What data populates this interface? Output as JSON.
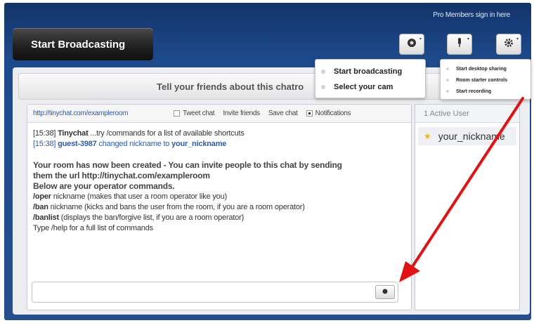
{
  "header": {
    "pro_link": "Pro Members sign in here",
    "start_button": "Start Broadcasting",
    "tools": [
      {
        "name": "camera-icon"
      },
      {
        "name": "microphone-icon"
      },
      {
        "name": "gear-icon"
      }
    ]
  },
  "tellbar": {
    "text": "Tell your friends about this chatro"
  },
  "chat": {
    "room_url": "http://tinychat.com/exampleroom",
    "toolbar": {
      "tweet": "Tweet chat",
      "invite": "Invite friends",
      "save": "Save chat",
      "notifications": "Notifications"
    },
    "lines": {
      "l1_time": "[15:38]",
      "l1_user": "Tinychat",
      "l1_text": "...try /commands for a list of available shortcuts",
      "l2_time": "[15:38]",
      "l2_user": "guest-3987",
      "l2_text": "changed nickname to",
      "l2_nick": "your_nickname",
      "welcome1": "Your room has now been created - You can invite people to this chat by sending",
      "welcome2": "them the url http://tinychat.com/exampleroom",
      "welcome3": "Below are your operator commands.",
      "cmd1": "/oper",
      "cmd1_arg": "nickname",
      "cmd1_desc": "(makes that user a room operator like you)",
      "cmd2": "/ban",
      "cmd2_arg": "nickname",
      "cmd2_desc": "(kicks and bans the user from the room, if you are a room operator)",
      "cmd3": "/banlist",
      "cmd3_desc": "(displays the ban/forgive list, if you are a room operator)",
      "help": "Type /help for a full list of commands"
    },
    "input": {
      "value": ""
    }
  },
  "users": {
    "header": "1 Active User",
    "list": [
      {
        "nickname": "your_nickname"
      }
    ]
  },
  "cam_menu": {
    "items": [
      "Start broadcasting",
      "Select your cam"
    ]
  },
  "settings_menu": {
    "items": [
      "Start desktop sharing",
      "Room starter controls",
      "Start recording"
    ]
  },
  "colors": {
    "frame": "#1d4a8c",
    "link": "#2a5db0",
    "arrow": "#e31212",
    "star": "#f2b316"
  }
}
